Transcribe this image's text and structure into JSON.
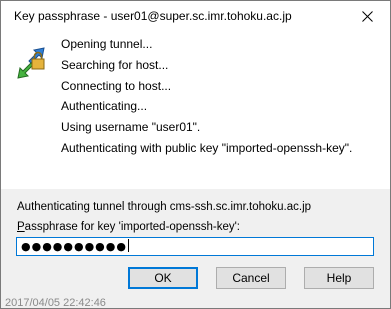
{
  "window": {
    "title": "Key passphrase - user01@super.sc.imr.tohoku.ac.jp",
    "close_glyph": "✕"
  },
  "icon": {
    "name": "putty-key-icon"
  },
  "log_lines": [
    "Opening tunnel...",
    "Searching for host...",
    "Connecting to host...",
    "Authenticating...",
    "Using username \"user01\".",
    "Authenticating with public key \"imported-openssh-key\"."
  ],
  "bottom": {
    "tunnel_text": "Authenticating tunnel through cms-ssh.sc.imr.tohoku.ac.jp",
    "passphrase_label_first": "P",
    "passphrase_label_rest": "assphrase for key 'imported-openssh-key':",
    "passphrase_value": "●●●●●●●●●●"
  },
  "buttons": {
    "ok": "OK",
    "cancel": "Cancel",
    "help": "Help"
  },
  "footer": {
    "text": "2017/04/05 22:42:46"
  },
  "colors": {
    "accent": "#0078d7",
    "panel": "#f0f0f0"
  }
}
